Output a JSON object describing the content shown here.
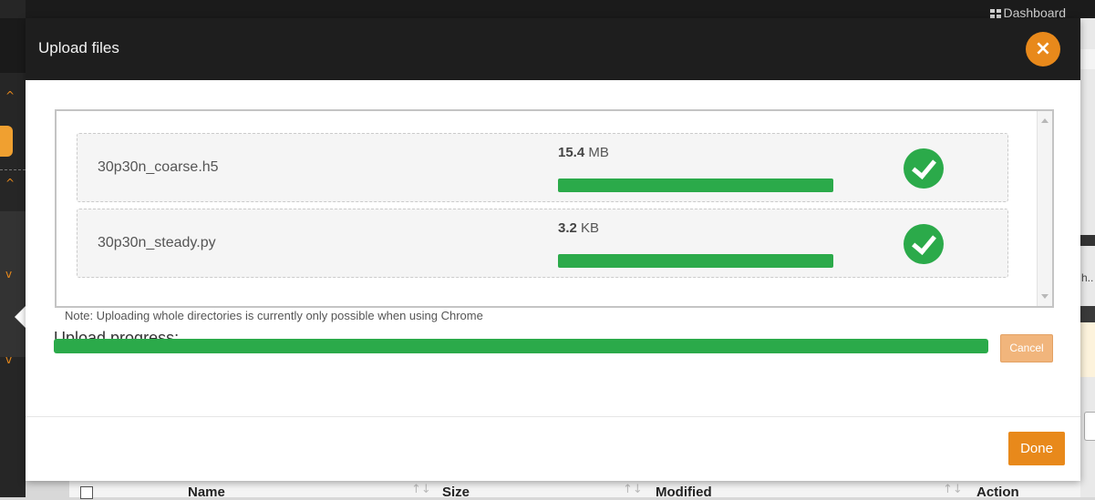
{
  "background": {
    "nav_link": "Dashboard",
    "nav_link_icon": "grid-icon",
    "right_truncated_text": "h..",
    "table_headers": {
      "name": "Name",
      "size": "Size",
      "modified": "Modified",
      "action": "Action"
    }
  },
  "modal": {
    "title": "Upload files",
    "close_icon": "×",
    "files": [
      {
        "name": "30p30n_coarse.h5",
        "size_value": "15.4",
        "size_unit": "MB",
        "progress": 1.0,
        "status_icon": "check-circle-icon"
      },
      {
        "name": "30p30n_steady.py",
        "size_value": "3.2",
        "size_unit": "KB",
        "progress": 1.0,
        "status_icon": "check-circle-icon"
      }
    ],
    "note": "Note: Uploading whole directories is currently only possible when using Chrome",
    "upload_progress_label": "Upload progress:",
    "upload_progress": 1.0,
    "cancel_label": "Cancel",
    "done_label": "Done"
  },
  "colors": {
    "accent_orange": "#e8891b",
    "success_green": "#2baa4a",
    "header_dark": "#1e1e1e"
  }
}
